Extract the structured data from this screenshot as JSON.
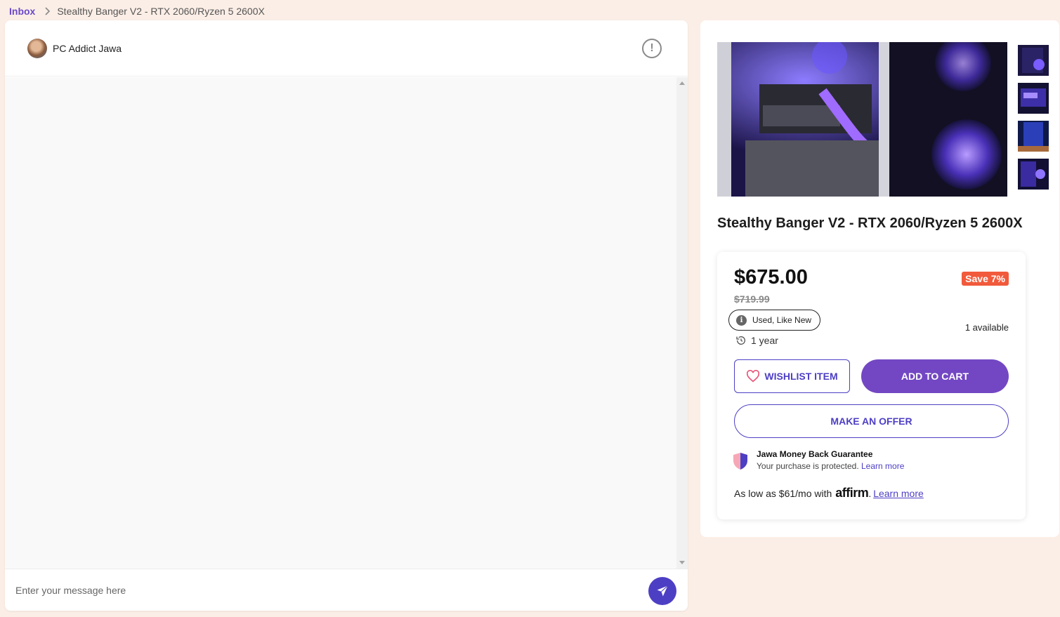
{
  "breadcrumb": {
    "inbox": "Inbox",
    "current": "Stealthy Banger V2 - RTX 2060/Ryzen 5 2600X"
  },
  "chat": {
    "contact_name": "PC Addict Jawa",
    "report_icon": "exclamation-circle-icon",
    "input_placeholder": "Enter your message here",
    "send_icon": "paper-plane-icon"
  },
  "product": {
    "title": "Stealthy Banger V2 - RTX 2060/Ryzen 5 2600X",
    "price": "$675.00",
    "original_price": "$719.99",
    "save_badge": "Save 7%",
    "condition": "Used, Like New",
    "availability": "1 available",
    "age": "1 year",
    "wishlist_label": "WISHLIST ITEM",
    "add_to_cart_label": "ADD TO CART",
    "make_offer_label": "MAKE AN OFFER",
    "guarantee_title": "Jawa Money Back Guarantee",
    "guarantee_text": "Your purchase is protected.",
    "guarantee_link": "Learn more",
    "financing_text": "As low as $61/mo with",
    "financing_brand": "affirm",
    "financing_suffix": ".",
    "financing_link": "Learn more"
  },
  "colors": {
    "accent": "#4d3fc4",
    "cart_button": "#7347c3",
    "save_badge": "#f15a3b",
    "background": "#fbeee6"
  }
}
